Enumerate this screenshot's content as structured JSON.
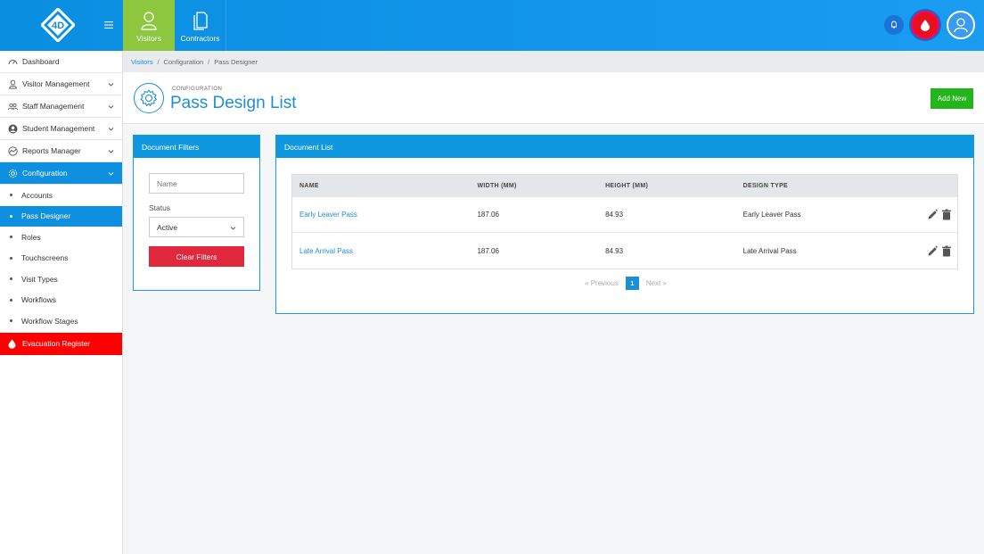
{
  "brand": {
    "logo_text": "4D"
  },
  "topnav": [
    {
      "label": "Visitors",
      "icon": "visitor-icon",
      "active": true
    },
    {
      "label": "Contractors",
      "icon": "document-icon",
      "active": false
    }
  ],
  "sidebar": {
    "items": [
      {
        "label": "Dashboard",
        "icon": "dashboard-icon"
      },
      {
        "label": "Visitor Management",
        "icon": "visitor-icon"
      },
      {
        "label": "Staff Management",
        "icon": "staff-icon"
      },
      {
        "label": "Student Management",
        "icon": "student-icon"
      },
      {
        "label": "Reports Manager",
        "icon": "reports-icon"
      },
      {
        "label": "Configuration",
        "icon": "gear-icon"
      }
    ],
    "sub_items": [
      "Accounts",
      "Pass Designer",
      "Roles",
      "Touchscreens",
      "Visit Types",
      "Workflows",
      "Workflow Stages"
    ],
    "evacuation": "Evacuation Register"
  },
  "breadcrumb": {
    "root": "Visitors",
    "mid": "Configuration",
    "current": "Pass Designer",
    "sep": "/"
  },
  "header": {
    "kicker": "CONFIGURATION",
    "title": "Pass Design List",
    "add_button": "Add New"
  },
  "filters": {
    "title": "Document Filters",
    "name_placeholder": "Name",
    "status_label": "Status",
    "status_value": "Active",
    "clear_button": "Clear Filters"
  },
  "doclist": {
    "title": "Document List",
    "columns": [
      "NAME",
      "WIDTH (MM)",
      "HEIGHT (MM)",
      "DESIGN TYPE"
    ],
    "rows": [
      {
        "name": "Early Leaver Pass",
        "width": "187.06",
        "height": "84.93",
        "type": "Early Leaver Pass"
      },
      {
        "name": "Late Arrival Pass",
        "width": "187.06",
        "height": "84.93",
        "type": "Late Arrival Pass"
      }
    ],
    "pager": {
      "prev": "« Previous",
      "page": "1",
      "next": "Next »"
    }
  },
  "colors": {
    "primary": "#1a8fd8",
    "active_nav": "#8dc63f",
    "danger": "#e2283c",
    "success": "#22b51c",
    "evac": "#ff0000"
  }
}
